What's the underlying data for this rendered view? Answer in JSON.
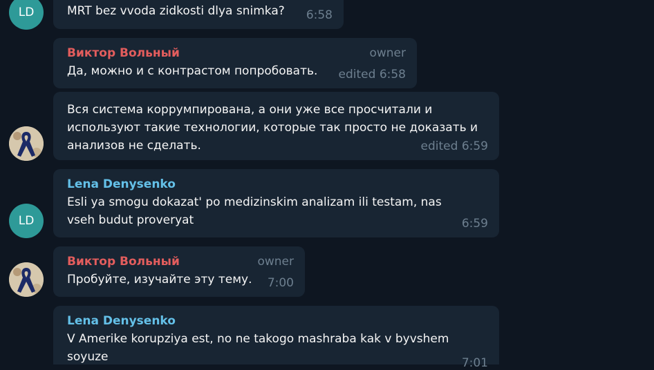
{
  "avatars": {
    "lena_initials": "LD"
  },
  "messages": [
    {
      "text": "MRT bez vvoda zidkosti dlya snimka?",
      "meta": "6:58"
    },
    {
      "sender": "Виктор Вольный",
      "role": "owner",
      "text": "Да, можно и с контрастом попробовать.",
      "meta": "edited 6:58"
    },
    {
      "text": "Вся система коррумпирована, а они уже все просчитали и используют такие технологии, которые так просто не доказать и анализов не сделать.",
      "meta": "edited 6:59"
    },
    {
      "sender": "Lena Denysenko",
      "text": "Esli ya smogu dokazat' po medizinskim analizam ili testam, nas vseh budut proveryat",
      "meta": "6:59"
    },
    {
      "sender": "Виктор Вольный",
      "role": "owner",
      "text": "Пробуйте, изучайте эту тему.",
      "meta": "7:00"
    },
    {
      "sender": "Lena Denysenko",
      "text": "V Amerike korupziya est, no ne takogo mashraba kak v byvshem soyuze",
      "meta": "7:01"
    }
  ],
  "colors": {
    "background": "#0e1621",
    "bubble": "#182533",
    "viktor_name": "#e35d5d",
    "lena_name": "#64c0e8",
    "lena_avatar": "#2e9a98",
    "meta_text": "#6d7f8f"
  }
}
